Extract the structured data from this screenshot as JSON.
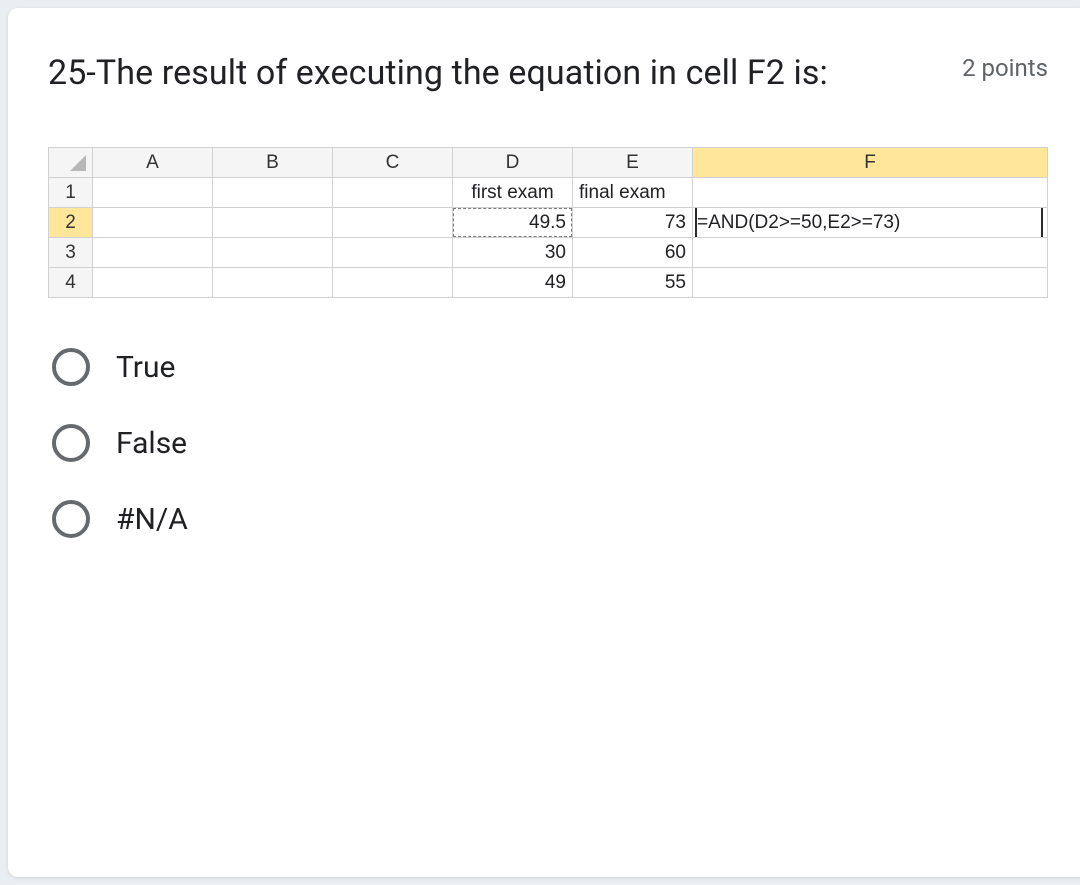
{
  "question": {
    "title": "25-The result of executing the equation in cell F2 is:",
    "points_label": "2 points"
  },
  "spreadsheet": {
    "columns": [
      "A",
      "B",
      "C",
      "D",
      "E",
      "F"
    ],
    "selected_col_index": 5,
    "selected_row_index": 1,
    "rows": [
      {
        "n": "1",
        "D": "first exam",
        "E": "final exam",
        "F": ""
      },
      {
        "n": "2",
        "D": "49.5",
        "E": "73",
        "F": "=AND(D2>=50,E2>=73)"
      },
      {
        "n": "3",
        "D": "30",
        "E": "60",
        "F": ""
      },
      {
        "n": "4",
        "D": "49",
        "E": "55",
        "F": ""
      }
    ]
  },
  "options": [
    {
      "label": "True"
    },
    {
      "label": "False"
    },
    {
      "label": "#N/A"
    }
  ]
}
